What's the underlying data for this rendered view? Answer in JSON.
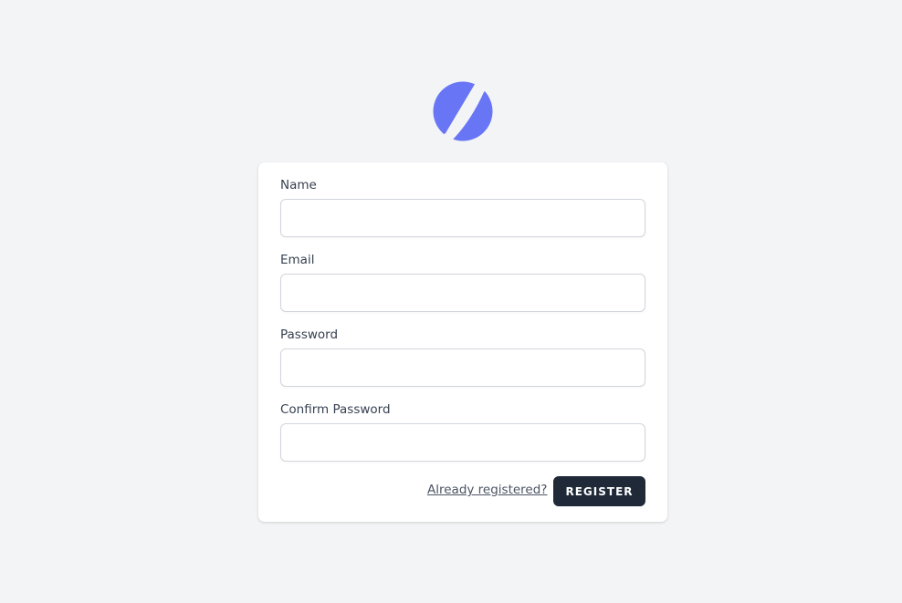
{
  "brand": {
    "logo_icon": "planet-logo-icon",
    "logo_color": "#6875f5"
  },
  "form": {
    "name_label": "Name",
    "name_value": "",
    "email_label": "Email",
    "email_value": "",
    "password_label": "Password",
    "password_value": "",
    "confirm_password_label": "Confirm Password",
    "confirm_password_value": "",
    "login_link": "Already registered?",
    "submit_label": "REGISTER"
  },
  "colors": {
    "background": "#f3f4f6",
    "card": "#ffffff",
    "button": "#1f2937"
  }
}
